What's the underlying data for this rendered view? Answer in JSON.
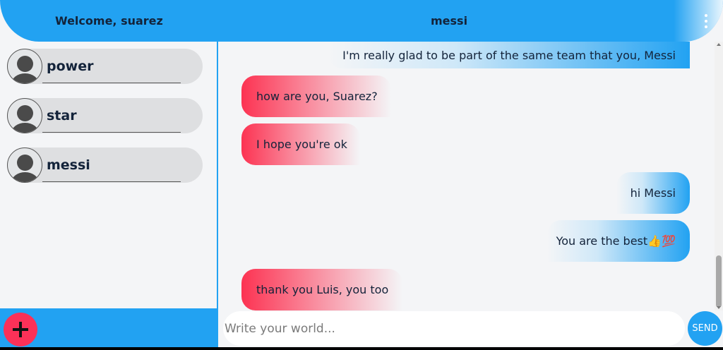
{
  "header": {
    "welcome": "Welcome, suarez",
    "chat_title": "messi",
    "menu_icon": "kebab-menu-icon"
  },
  "sidebar": {
    "contacts": [
      {
        "name": "power",
        "icon": "user-avatar-icon"
      },
      {
        "name": "star",
        "icon": "user-avatar-icon"
      },
      {
        "name": "messi",
        "icon": "user-avatar-icon"
      }
    ],
    "add_button_icon": "plus-icon"
  },
  "messages": [
    {
      "direction": "sent",
      "text": "I'm really glad to be part of the same team that you, Messi"
    },
    {
      "direction": "received",
      "text": "how are you, Suarez?"
    },
    {
      "direction": "received",
      "text": "I hope you're ok"
    },
    {
      "direction": "sent",
      "text": "hi Messi"
    },
    {
      "direction": "sent",
      "text": "You are the best👍💯"
    },
    {
      "direction": "received",
      "text": "thank you Luis, you too"
    }
  ],
  "composer": {
    "placeholder": "Write your world...",
    "value": "",
    "send_label": "SEND"
  },
  "colors": {
    "accent": "#22a2f2",
    "received_bubble": "#fc3352",
    "fab": "#fb3158",
    "background": "#f4f5f7"
  }
}
